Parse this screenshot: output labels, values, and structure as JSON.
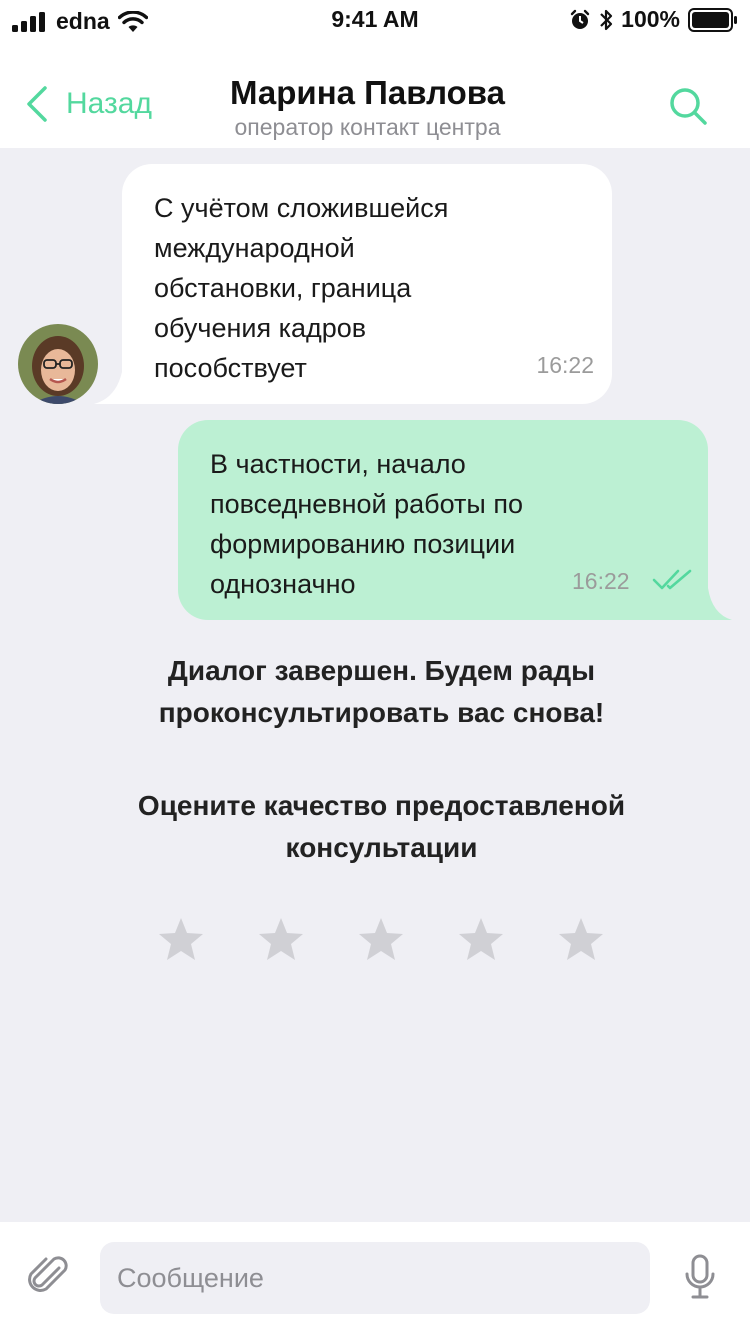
{
  "status_bar": {
    "carrier": "edna",
    "time": "9:41 AM",
    "battery": "100%"
  },
  "header": {
    "back_label": "Назад",
    "title": "Марина Павлова",
    "subtitle": "оператор контакт центра"
  },
  "messages": [
    {
      "direction": "incoming",
      "text": "С учётом сложившейся\nмеждународной\nобстановки, граница\nобучения кадров\nпособствует",
      "time": "16:22"
    },
    {
      "direction": "outgoing",
      "text": "В частности, начало\nповседневной работы по\nформированию позиции\nоднозначно",
      "time": "16:22",
      "status": "read"
    }
  ],
  "dialog_ended": "Диалог завершен. Будем рады\nпроконсультировать вас снова!",
  "rating": {
    "prompt": "Оцените качество предоставленой\nконсультации",
    "max": 5,
    "value": 0
  },
  "composer": {
    "placeholder": "Сообщение"
  },
  "colors": {
    "accent": "#53d89e",
    "outgoing_bubble": "#bcf0d3",
    "background": "#efeff4",
    "star_inactive": "#d0d0d5"
  },
  "icons": [
    "signal-icon",
    "wifi-icon",
    "alarm-icon",
    "bluetooth-icon",
    "battery-icon",
    "chevron-left-icon",
    "search-icon",
    "double-check-icon",
    "star-icon",
    "paperclip-icon",
    "microphone-icon"
  ]
}
